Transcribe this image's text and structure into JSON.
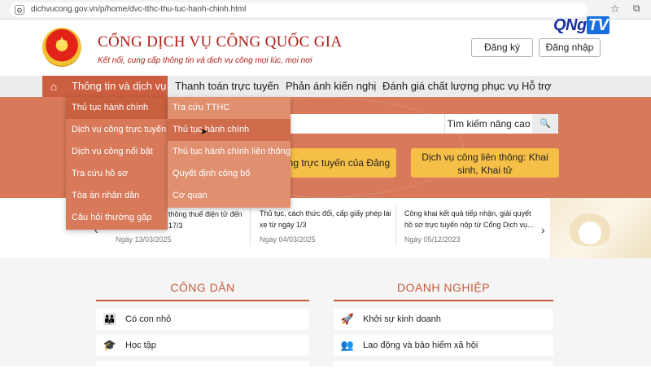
{
  "browser": {
    "url": "dichvucong.gov.vn/p/home/dvc-tthc-thu-tuc-hanh-chinh.html"
  },
  "header": {
    "title": "CỔNG DỊCH VỤ CÔNG QUỐC GIA",
    "subtitle": "Kết nối, cung cấp thông tin và dịch vụ công mọi lúc, mọi nơi",
    "register": "Đăng ký",
    "login": "Đăng nhập",
    "watermark": "QNgTV"
  },
  "nav": {
    "items": [
      "Thông tin và dịch vụ",
      "Thanh toán trực tuyến",
      "Phản ánh kiến nghị",
      "Đánh giá chất lượng phục vụ",
      "Hỗ trợ"
    ]
  },
  "dropdown_main": [
    "Thủ tục hành chính",
    "Dịch vụ công trực tuyến",
    "Dịch vụ công nổi bật",
    "Tra cứu hồ sơ",
    "Tòa án nhân dân",
    "Câu hỏi thường gặp"
  ],
  "dropdown_sub": [
    "Tra cứu TTHC",
    "Thủ tục hành chính",
    "Thủ tục hành chính liên thông",
    "Quyết định công bố",
    "Cơ quan"
  ],
  "hero": {
    "advanced_search": "Tìm kiếm nâng cao",
    "card_party": "công trực tuyến của Đảng",
    "card_birth": "Dịch vụ công liên thông: Khai sinh, Khai tử"
  },
  "news": [
    {
      "title": "thông thuế điện tử đến 17/3",
      "date": "Ngày 13/03/2025"
    },
    {
      "title": "Thủ tục, cách thức đổi, cấp giấy phép lái xe từ ngày 1/3",
      "date": "Ngày 04/03/2025"
    },
    {
      "title": "Công khai kết quả tiếp nhận, giải quyết hồ sơ trực tuyến nộp từ Cổng Dịch vụ...",
      "date": "Ngày 05/12/2023"
    }
  ],
  "sections": {
    "citizen": {
      "title": "CÔNG DÂN",
      "items": [
        "Có con nhỏ",
        "Học tập"
      ]
    },
    "business": {
      "title": "DOANH NGHIỆP",
      "items": [
        "Khởi sự kinh doanh",
        "Lao động và bảo hiểm xã hội"
      ]
    }
  }
}
